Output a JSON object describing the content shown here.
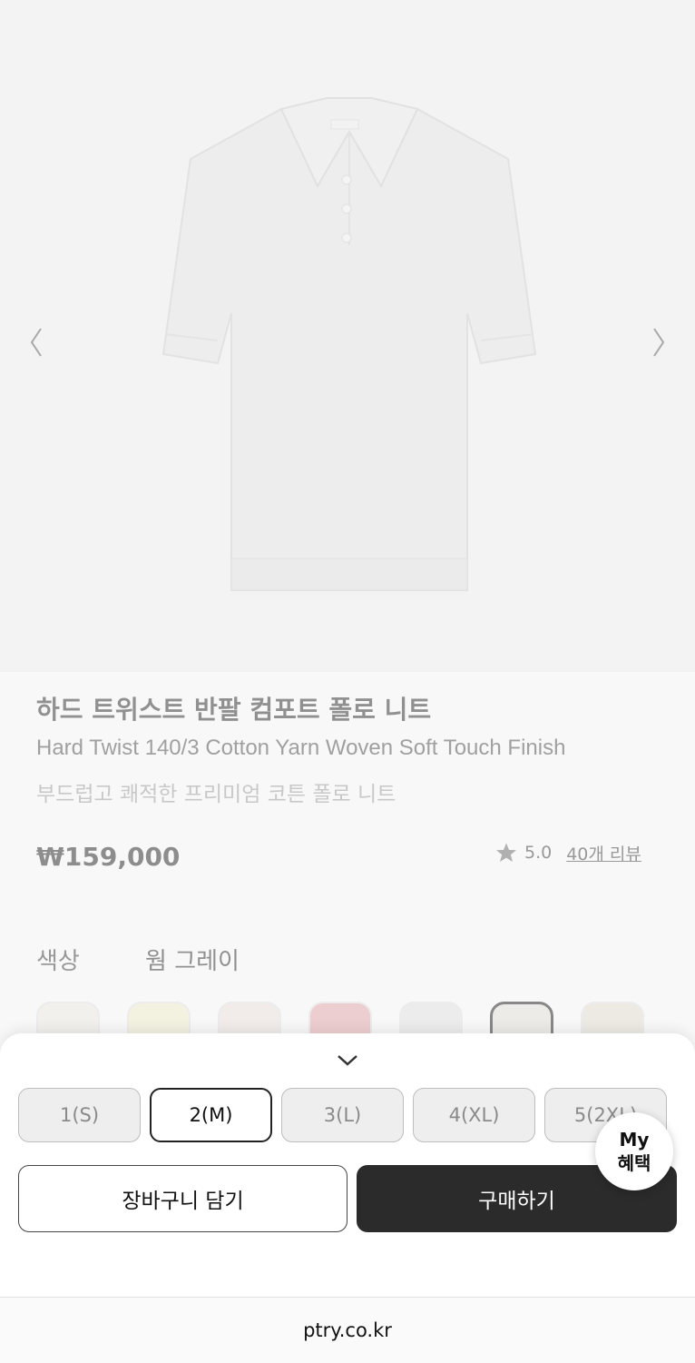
{
  "product": {
    "title": "하드 트위스트 반팔 컴포트 폴로 니트",
    "subtitle": "Hard Twist 140/3 Cotton Yarn Woven Soft Touch Finish",
    "description": "부드럽고 쾌적한 프리미엄 코튼 폴로 니트",
    "price": "₩159,000",
    "rating": "5.0",
    "review_link": "40개 리뷰"
  },
  "gallery": {
    "prev_icon": "chevron-left-icon",
    "next_icon": "chevron-right-icon",
    "image": "short-sleeve-polo-knit"
  },
  "color": {
    "label": "색상",
    "selected_name": "웜 그레이",
    "swatches": [
      {
        "name": "ivory",
        "hex": "#f2efe8"
      },
      {
        "name": "light-yellow",
        "hex": "#f5f2cc"
      },
      {
        "name": "light-pink",
        "hex": "#f1e6e3"
      },
      {
        "name": "pink",
        "hex": "#e9a6ab"
      },
      {
        "name": "light-gray",
        "hex": "#e6e6e8"
      },
      {
        "name": "warm-gray",
        "hex": "#e9e5dc",
        "selected": true
      },
      {
        "name": "beige",
        "hex": "#e8e2d6"
      }
    ]
  },
  "sheet": {
    "collapse_icon": "chevron-down-icon",
    "sizes": [
      {
        "label": "1(S)",
        "selected": false
      },
      {
        "label": "2(M)",
        "selected": true
      },
      {
        "label": "3(L)",
        "selected": false
      },
      {
        "label": "4(XL)",
        "selected": false
      },
      {
        "label": "5(2XL)",
        "selected": false
      }
    ],
    "cart_label": "장바구니 담기",
    "buy_label": "구매하기"
  },
  "my_benefits": {
    "line1": "My",
    "line2": "혜택"
  },
  "browser": {
    "url": "ptry.co.kr"
  },
  "colors": {
    "accent_dark": "#2b2b2b",
    "star": "#666666"
  }
}
